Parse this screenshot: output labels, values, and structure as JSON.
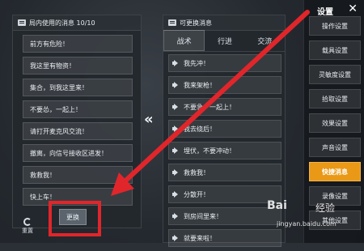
{
  "left_panel": {
    "title": "局内使用的消息 10/10",
    "messages": [
      "前方有危险！",
      "我这里有物资！",
      "集合，到我这里来！",
      "不要怂，一起上！",
      "请打开麦克风交流！",
      "撤离，向信号接收区进发！",
      "救救我！",
      "快上车！"
    ],
    "reset_label": "重置",
    "change_label": "更换"
  },
  "middle_panel": {
    "title": "可更换消息",
    "tabs": [
      "战术",
      "行进",
      "交流"
    ],
    "messages": [
      "我先冲！",
      "我来架枪！",
      "不要急，一起上！",
      "我去绕后！",
      "埋伏，不要冲动！",
      "救救我！",
      "分散开！",
      "到房间里来！",
      "就要来啦！"
    ]
  },
  "settings": {
    "title": "设置",
    "items": [
      "操作设置",
      "载具设置",
      "灵敏度设置",
      "拾取设置",
      "效果设置",
      "声音设置",
      "快捷消息",
      "录像设置",
      "其他设置"
    ],
    "active_index": 6,
    "accent": "#e99916"
  },
  "watermark": {
    "logo": "Bai",
    "name": "经验",
    "url": "jingyan.baidu.com"
  },
  "highlight_color": "#e0262b",
  "icons": {
    "left_title": "chat-bubble-icon",
    "middle_title": "chat-bubble-icon",
    "reset": "refresh-icon",
    "swap": "double-left-chevron-icon",
    "speaker": "speaker-icon",
    "close": "close-icon"
  }
}
